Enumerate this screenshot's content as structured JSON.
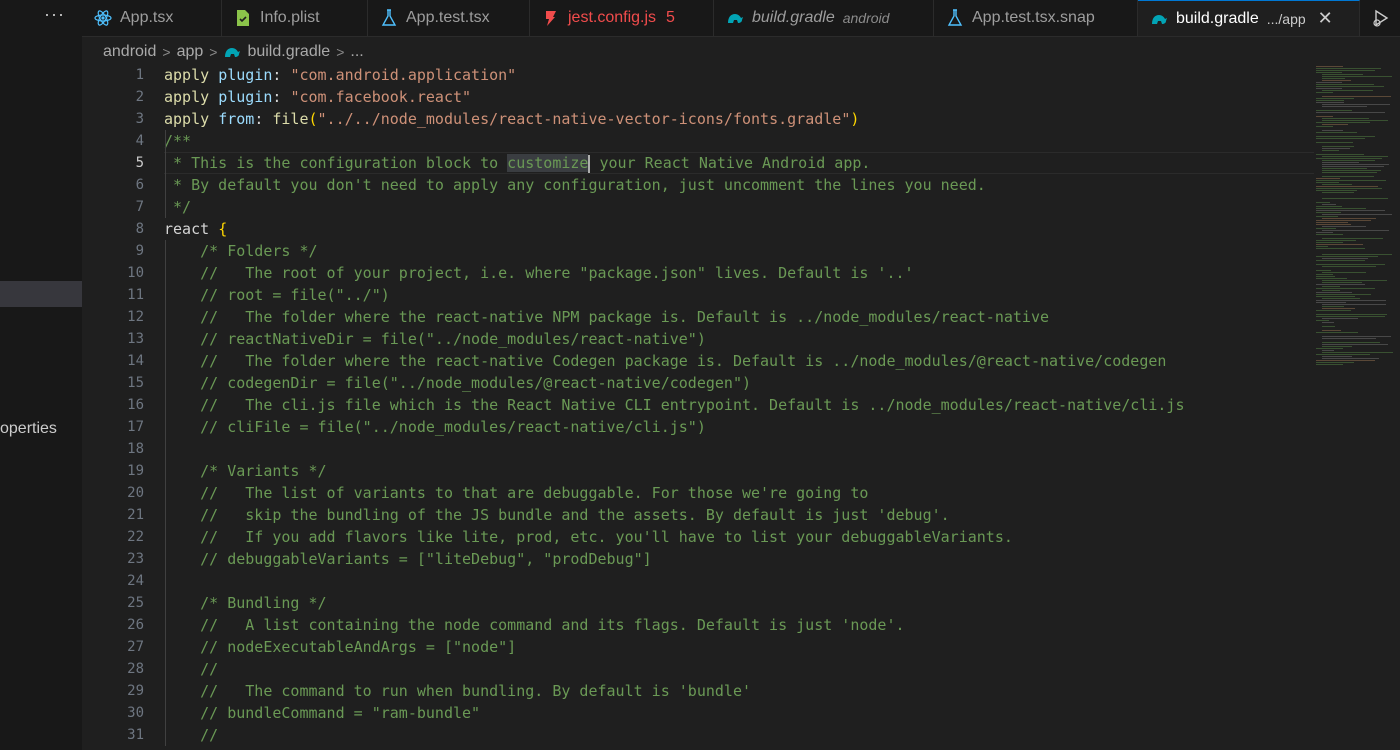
{
  "sidebar": {
    "more_label": "···",
    "visible_fragment": "operties"
  },
  "tabs": [
    {
      "label": "App.tsx",
      "icon": "react-icon",
      "color": "#4fc1ff"
    },
    {
      "label": "Info.plist",
      "icon": "plist-file-icon",
      "color": "#8bc34a"
    },
    {
      "label": "App.test.tsx",
      "icon": "flask-icon",
      "color": "#4fc1ff"
    },
    {
      "label": "jest.config.js",
      "icon": "jest-icon",
      "color": "#f14c4c",
      "badge": "5"
    },
    {
      "label": "build.gradle",
      "icon": "gradle-icon",
      "color": "#02a4b5",
      "description": "android"
    },
    {
      "label": "App.test.tsx.snap",
      "icon": "flask-icon",
      "color": "#4fc1ff"
    },
    {
      "label": "build.gradle",
      "icon": "gradle-icon",
      "color": "#02a4b5",
      "description": ".../app",
      "active": true
    }
  ],
  "breadcrumb": {
    "items": [
      "android",
      "app",
      "build.gradle",
      "..."
    ]
  },
  "editor": {
    "current_line": 5,
    "lines": [
      {
        "n": "1",
        "segs": [
          [
            "kw",
            "apply"
          ],
          [
            "plain",
            " "
          ],
          [
            "id",
            "plugin"
          ],
          [
            "plain",
            ": "
          ],
          [
            "str",
            "\"com.android.application\""
          ]
        ]
      },
      {
        "n": "2",
        "segs": [
          [
            "kw",
            "apply"
          ],
          [
            "plain",
            " "
          ],
          [
            "id",
            "plugin"
          ],
          [
            "plain",
            ": "
          ],
          [
            "str",
            "\"com.facebook.react\""
          ]
        ]
      },
      {
        "n": "3",
        "segs": [
          [
            "kw",
            "apply"
          ],
          [
            "plain",
            " "
          ],
          [
            "id",
            "from"
          ],
          [
            "plain",
            ": "
          ],
          [
            "fn",
            "file"
          ],
          [
            "br",
            "("
          ],
          [
            "str",
            "\"../../node_modules/react-native-vector-icons/fonts.gradle\""
          ],
          [
            "br",
            ")"
          ]
        ]
      },
      {
        "n": "4",
        "segs": [
          [
            "cm",
            "/**"
          ]
        ]
      },
      {
        "n": "5",
        "segs": [
          [
            "cm",
            " * This is the configuration block to "
          ],
          [
            "cmhl",
            "customize"
          ],
          [
            "cursor",
            ""
          ],
          [
            "cm",
            " your React Native Android app."
          ]
        ]
      },
      {
        "n": "6",
        "segs": [
          [
            "cm",
            " * By default you don't need to apply any configuration, just uncomment the lines you need."
          ]
        ]
      },
      {
        "n": "7",
        "segs": [
          [
            "cm",
            " */"
          ]
        ]
      },
      {
        "n": "8",
        "segs": [
          [
            "plain",
            "react "
          ],
          [
            "br",
            "{"
          ]
        ]
      },
      {
        "n": "9",
        "segs": [
          [
            "cm",
            "    /* Folders */"
          ]
        ]
      },
      {
        "n": "10",
        "segs": [
          [
            "cm",
            "    //   The root of your project, i.e. where \"package.json\" lives. Default is '..'"
          ]
        ]
      },
      {
        "n": "11",
        "segs": [
          [
            "cm",
            "    // root = file(\"../\")"
          ]
        ]
      },
      {
        "n": "12",
        "segs": [
          [
            "cm",
            "    //   The folder where the react-native NPM package is. Default is ../node_modules/react-native"
          ]
        ]
      },
      {
        "n": "13",
        "segs": [
          [
            "cm",
            "    // reactNativeDir = file(\"../node_modules/react-native\")"
          ]
        ]
      },
      {
        "n": "14",
        "segs": [
          [
            "cm",
            "    //   The folder where the react-native Codegen package is. Default is ../node_modules/@react-native/codegen"
          ]
        ]
      },
      {
        "n": "15",
        "segs": [
          [
            "cm",
            "    // codegenDir = file(\"../node_modules/@react-native/codegen\")"
          ]
        ]
      },
      {
        "n": "16",
        "segs": [
          [
            "cm",
            "    //   The cli.js file which is the React Native CLI entrypoint. Default is ../node_modules/react-native/cli.js"
          ]
        ]
      },
      {
        "n": "17",
        "segs": [
          [
            "cm",
            "    // cliFile = file(\"../node_modules/react-native/cli.js\")"
          ]
        ]
      },
      {
        "n": "18",
        "segs": []
      },
      {
        "n": "19",
        "segs": [
          [
            "cm",
            "    /* Variants */"
          ]
        ]
      },
      {
        "n": "20",
        "segs": [
          [
            "cm",
            "    //   The list of variants to that are debuggable. For those we're going to"
          ]
        ]
      },
      {
        "n": "21",
        "segs": [
          [
            "cm",
            "    //   skip the bundling of the JS bundle and the assets. By default is just 'debug'."
          ]
        ]
      },
      {
        "n": "22",
        "segs": [
          [
            "cm",
            "    //   If you add flavors like lite, prod, etc. you'll have to list your debuggableVariants."
          ]
        ]
      },
      {
        "n": "23",
        "segs": [
          [
            "cm",
            "    // debuggableVariants = [\"liteDebug\", \"prodDebug\"]"
          ]
        ]
      },
      {
        "n": "24",
        "segs": []
      },
      {
        "n": "25",
        "segs": [
          [
            "cm",
            "    /* Bundling */"
          ]
        ]
      },
      {
        "n": "26",
        "segs": [
          [
            "cm",
            "    //   A list containing the node command and its flags. Default is just 'node'."
          ]
        ]
      },
      {
        "n": "27",
        "segs": [
          [
            "cm",
            "    // nodeExecutableAndArgs = [\"node\"]"
          ]
        ]
      },
      {
        "n": "28",
        "segs": [
          [
            "cm",
            "    //"
          ]
        ]
      },
      {
        "n": "29",
        "segs": [
          [
            "cm",
            "    //   The command to run when bundling. By default is 'bundle'"
          ]
        ]
      },
      {
        "n": "30",
        "segs": [
          [
            "cm",
            "    // bundleCommand = \"ram-bundle\""
          ]
        ]
      },
      {
        "n": "31",
        "segs": [
          [
            "cm",
            "    //"
          ]
        ]
      }
    ]
  }
}
